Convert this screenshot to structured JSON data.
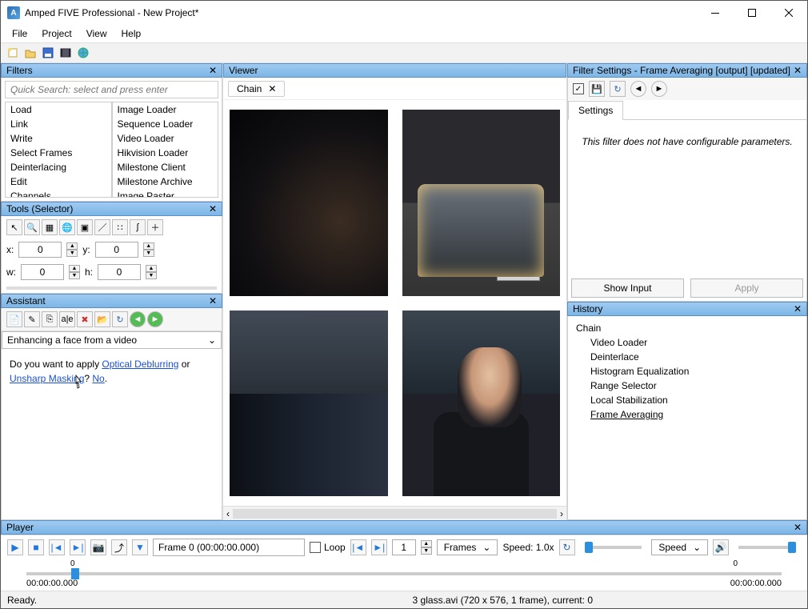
{
  "title": "Amped FIVE Professional - New Project*",
  "menu": [
    "File",
    "Project",
    "View",
    "Help"
  ],
  "filters_panel": {
    "title": "Filters",
    "search_placeholder": "Quick Search: select and press enter",
    "left": [
      "Load",
      "Link",
      "Write",
      "Select Frames",
      "Deinterlacing",
      "Edit",
      "Channels"
    ],
    "right": [
      "Image Loader",
      "Sequence Loader",
      "Video Loader",
      "Hikvision Loader",
      "Milestone Client",
      "Milestone Archive",
      "Image Paster"
    ]
  },
  "tools_panel": {
    "title": "Tools (Selector)",
    "x_label": "x:",
    "x_val": "0",
    "y_label": "y:",
    "y_val": "0",
    "w_label": "w:",
    "w_val": "0",
    "h_label": "h:",
    "h_val": "0"
  },
  "assistant": {
    "title": "Assistant",
    "mode": "Enhancing a face from a video",
    "q_prefix": "Do you want to apply ",
    "link1": "Optical Deblurring",
    "or": " or ",
    "link2": "Unsharp Masking",
    "q_suffix": "? ",
    "no": "No",
    "dot": "."
  },
  "viewer": {
    "title": "Viewer",
    "tab": "Chain"
  },
  "filter_settings": {
    "title": "Filter Settings - Frame Averaging [output] [updated]",
    "tab": "Settings",
    "body": "This filter does not have configurable parameters.",
    "show_input": "Show Input",
    "apply": "Apply"
  },
  "history": {
    "title": "History",
    "root": "Chain",
    "items": [
      "Video Loader",
      "Deinterlace",
      "Histogram Equalization",
      "Range Selector",
      "Local Stabilization",
      "Frame Averaging"
    ]
  },
  "player": {
    "title": "Player",
    "frame_text": "Frame 0 (00:00:00.000)",
    "loop": "Loop",
    "frame_n": "1",
    "frames_drop": "Frames",
    "speed_label": "Speed: 1.0x",
    "speed_drop": "Speed",
    "tl_tick": "0",
    "tl_time_l": "00:00:00.000",
    "tl_time_r": "00:00:00.000"
  },
  "status": {
    "left": "Ready.",
    "right": "3 glass.avi (720 x 576, 1 frame), current: 0"
  }
}
